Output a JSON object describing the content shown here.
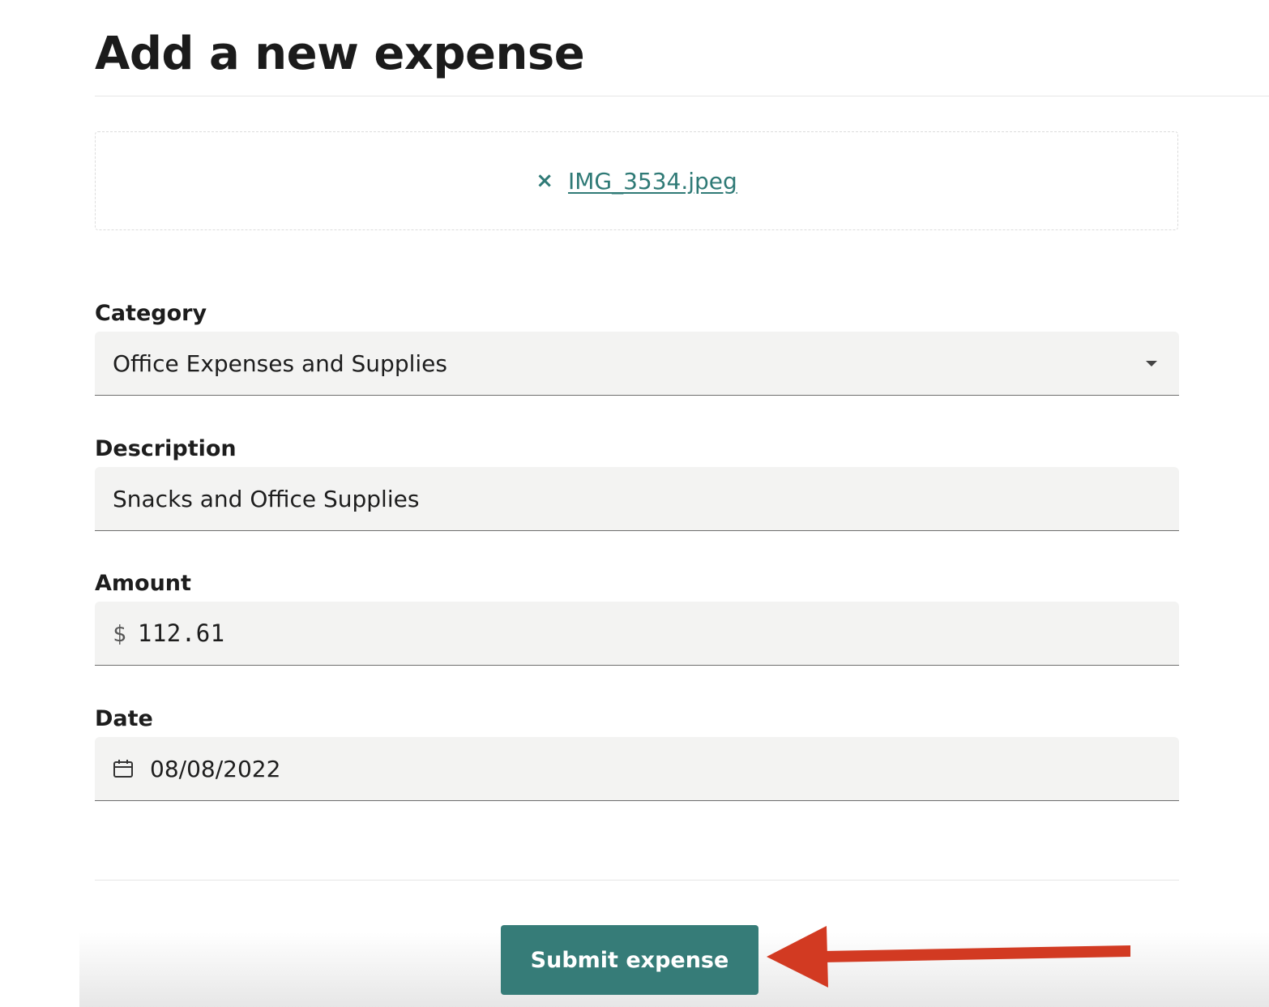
{
  "page": {
    "title": "Add a new expense"
  },
  "attachment": {
    "remove_icon": "close-icon",
    "remove_symbol": "×",
    "file_name": "IMG_3534.jpeg"
  },
  "form": {
    "category": {
      "label": "Category",
      "value": "Office Expenses and Supplies",
      "icon": "chevron-down-icon"
    },
    "description": {
      "label": "Description",
      "value": "Snacks and Office Supplies"
    },
    "amount": {
      "label": "Amount",
      "currency_symbol": "$",
      "value": "112.61"
    },
    "date": {
      "label": "Date",
      "value": "08/08/2022",
      "icon": "calendar-icon"
    }
  },
  "actions": {
    "submit_label": "Submit expense"
  },
  "colors": {
    "accent": "#367c78",
    "link": "#2f7a76",
    "field_bg": "#f3f3f2",
    "annotation_arrow": "#d23a22"
  }
}
